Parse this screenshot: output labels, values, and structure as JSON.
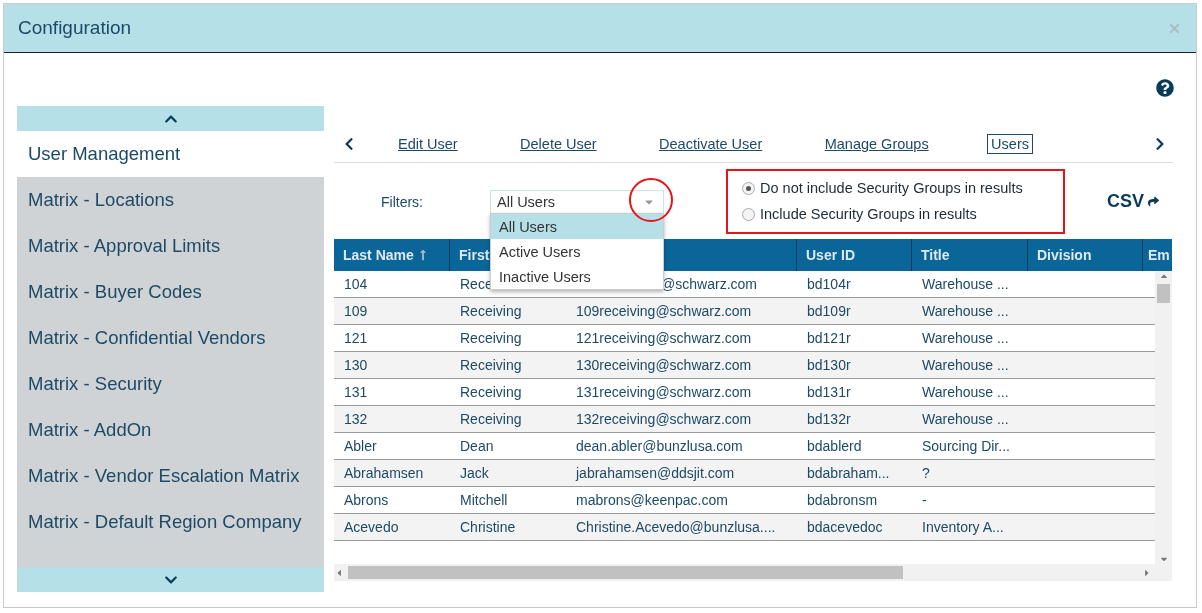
{
  "window": {
    "title": "Configuration"
  },
  "sidebar": {
    "items": [
      {
        "label": "User Management",
        "selected": true
      },
      {
        "label": "Matrix - Locations",
        "selected": false
      },
      {
        "label": "Matrix - Approval Limits",
        "selected": false
      },
      {
        "label": "Matrix - Buyer Codes",
        "selected": false
      },
      {
        "label": "Matrix - Confidential Vendors",
        "selected": false
      },
      {
        "label": "Matrix - Security",
        "selected": false
      },
      {
        "label": "Matrix - AddOn",
        "selected": false
      },
      {
        "label": "Matrix - Vendor Escalation Matrix",
        "selected": false
      },
      {
        "label": "Matrix - Default Region Company",
        "selected": false
      }
    ]
  },
  "toolbar": {
    "links": [
      {
        "label": "Edit User",
        "selected": false
      },
      {
        "label": "Delete User",
        "selected": false
      },
      {
        "label": "Deactivate User",
        "selected": false
      },
      {
        "label": "Manage Groups",
        "selected": false
      },
      {
        "label": "Users",
        "selected": true
      }
    ]
  },
  "filters": {
    "label": "Filters:",
    "value": "All Users",
    "expanded": true,
    "options": [
      {
        "label": "All Users",
        "selected": true
      },
      {
        "label": "Active Users",
        "selected": false
      },
      {
        "label": "Inactive Users",
        "selected": false
      }
    ]
  },
  "security_options": [
    {
      "label": "Do not include Security Groups in results",
      "selected": true
    },
    {
      "label": "Include Security Groups in results",
      "selected": false
    }
  ],
  "export": {
    "label": "CSV"
  },
  "table": {
    "columns": [
      {
        "label": "Last Name",
        "sorted": true
      },
      {
        "label": "First"
      },
      {},
      {
        "label": "User ID"
      },
      {
        "label": "Title"
      },
      {
        "label": "Division"
      },
      {
        "label": "Em"
      }
    ],
    "rows": [
      [
        "104",
        "Rece",
        "@schwarz.com",
        "bd104r",
        "Warehouse ..."
      ],
      [
        "109",
        "Receiving",
        "109receiving@schwarz.com",
        "bd109r",
        "Warehouse ..."
      ],
      [
        "121",
        "Receiving",
        "121receiving@schwarz.com",
        "bd121r",
        "Warehouse ..."
      ],
      [
        "130",
        "Receiving",
        "130receiving@schwarz.com",
        "bd130r",
        "Warehouse ..."
      ],
      [
        "131",
        "Receiving",
        "131receiving@schwarz.com",
        "bd131r",
        "Warehouse ..."
      ],
      [
        "132",
        "Receiving",
        "132receiving@schwarz.com",
        "bd132r",
        "Warehouse ..."
      ],
      [
        "Abler",
        "Dean",
        "dean.abler@bunzlusa.com",
        "bdablerd",
        "Sourcing Dir..."
      ],
      [
        "Abrahamsen",
        "Jack",
        "jabrahamsen@ddsjit.com",
        "bdabraham...",
        "?"
      ],
      [
        "Abrons",
        "Mitchell",
        "mabrons@keenpac.com",
        "bdabronsm",
        "-"
      ],
      [
        "Acevedo",
        "Christine",
        "Christine.Acevedo@bunzlusa....",
        "bdacevedoc",
        "Inventory A..."
      ]
    ]
  }
}
